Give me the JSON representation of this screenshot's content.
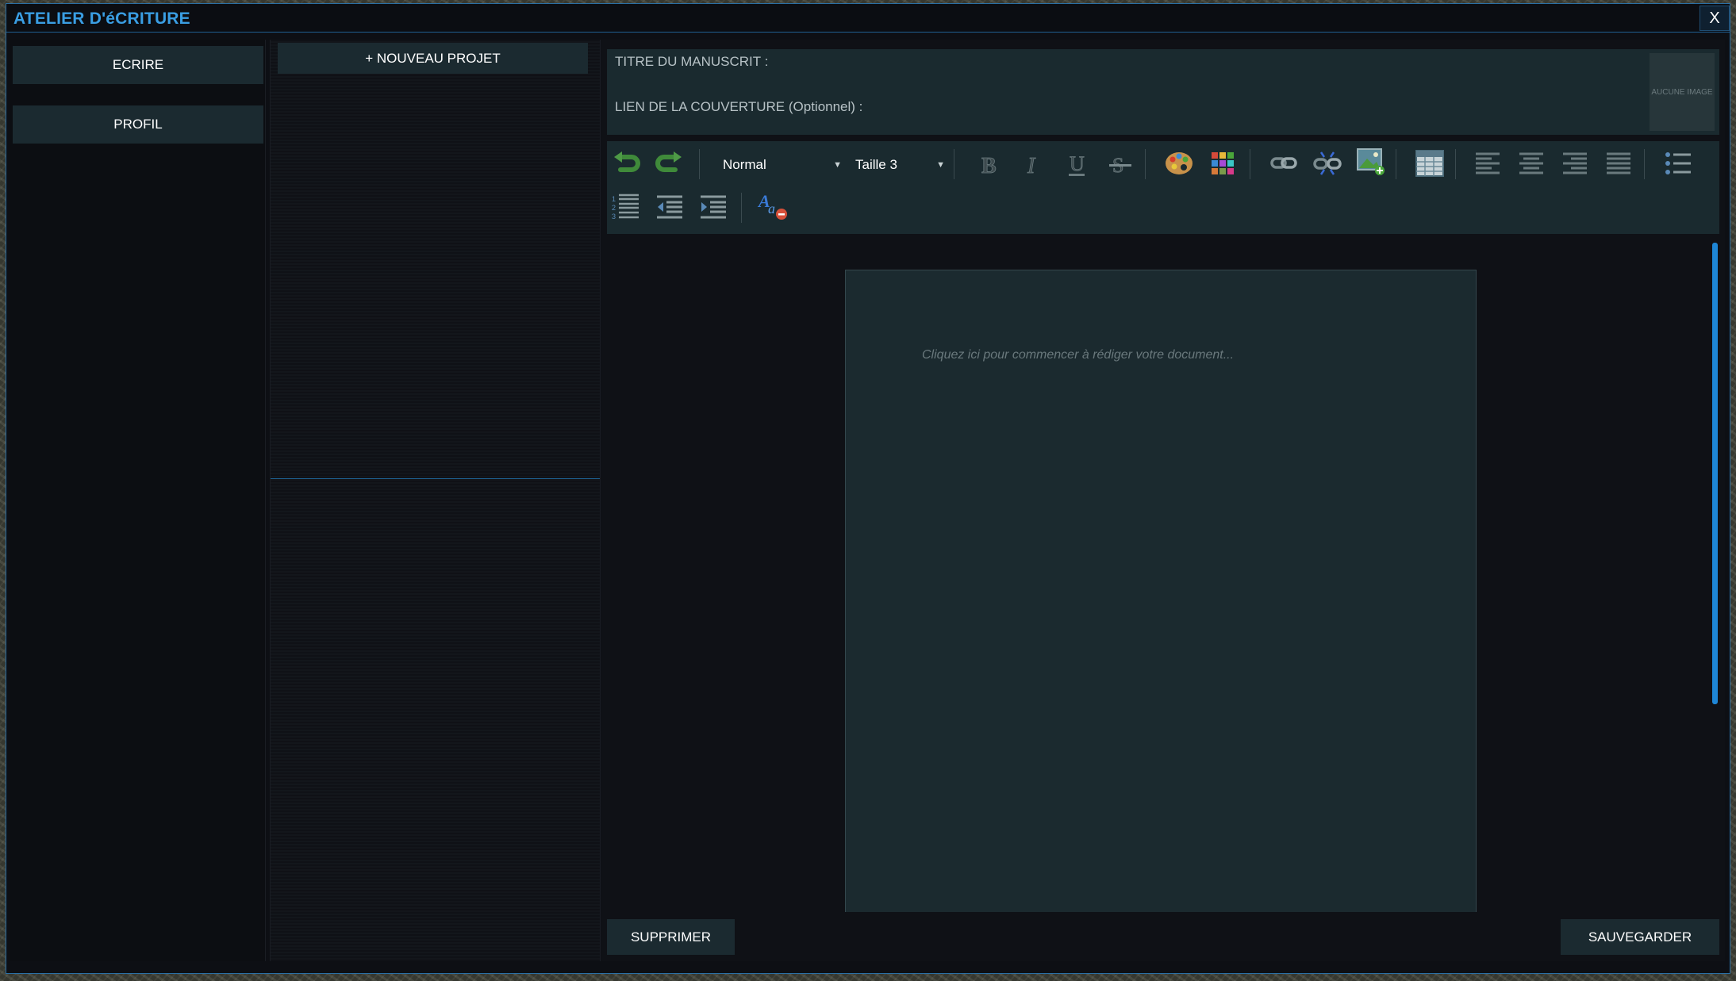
{
  "window": {
    "title": "ATELIER D'éCRITURE",
    "close_label": "X"
  },
  "sidebar": {
    "items": [
      {
        "label": "ECRIRE"
      },
      {
        "label": "PROFIL"
      }
    ]
  },
  "projects": {
    "new_project_label": "+ NOUVEAU PROJET"
  },
  "manuscript": {
    "title_label": "TITRE DU MANUSCRIT :",
    "cover_label": "LIEN DE LA COUVERTURE (Optionnel) :",
    "cover_placeholder": "AUCUNE IMAGE"
  },
  "toolbar": {
    "style_value": "Normal",
    "size_value": "Taille 3",
    "icons": [
      "undo-icon",
      "redo-icon",
      "bold-icon",
      "italic-icon",
      "underline-icon",
      "strikethrough-icon",
      "text-color-icon",
      "background-color-icon",
      "link-icon",
      "unlink-icon",
      "insert-image-icon",
      "table-icon",
      "align-left-icon",
      "align-center-icon",
      "align-right-icon",
      "align-justify-icon",
      "bullet-list-icon",
      "numbered-list-icon",
      "outdent-icon",
      "indent-icon",
      "remove-format-icon"
    ]
  },
  "editor": {
    "placeholder": "Cliquez ici pour commencer à rédiger votre document..."
  },
  "footer": {
    "delete_label": "SUPPRIMER",
    "save_label": "SAUVEGARDER"
  },
  "colors": {
    "accent": "#3a9ee3",
    "panel": "#1a2a2f",
    "background": "#0d0f14",
    "scrollbar": "#1e86d6"
  }
}
